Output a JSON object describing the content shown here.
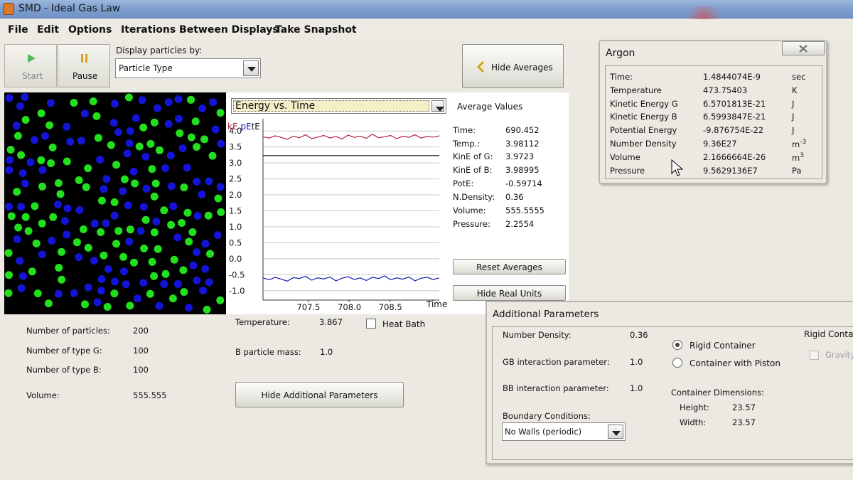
{
  "window": {
    "title": "SMD - Ideal Gas Law"
  },
  "menu": [
    "File",
    "Edit",
    "Options",
    "Iterations Between Displays",
    "Take Snapshot"
  ],
  "toolbar": {
    "start_label": "Start",
    "pause_label": "Pause",
    "display_by_label": "Display particles by:",
    "display_by_value": "Particle Type",
    "hide_averages_label": "Hide Averages"
  },
  "colors": {
    "type_g": "#22e01e",
    "type_b": "#1414d8",
    "ke_line": "#b0203c",
    "pe_line": "#1a1ab0",
    "te_line": "#111111"
  },
  "plot": {
    "selector_value": "Energy vs. Time",
    "legend": {
      "ke": "kE",
      "pe": "pE",
      "te": "tE"
    },
    "x_axis_label": "Time"
  },
  "chart_data": {
    "type": "line",
    "xlabel": "Time",
    "ylabel": "",
    "x_ticks": [
      "707.5",
      "708.0",
      "708.5"
    ],
    "y_ticks": [
      "4.0",
      "3.5",
      "3.0",
      "2.5",
      "2.0",
      "1.5",
      "1.0",
      "0.5",
      "0.0",
      "-0.5",
      "-1.0"
    ],
    "ylim": [
      -1.25,
      4.25
    ],
    "xlim": [
      706.95,
      709.1
    ],
    "series": [
      {
        "name": "kE",
        "color": "#b0203c",
        "values": [
          3.82,
          3.78,
          3.85,
          3.8,
          3.74,
          3.84,
          3.79,
          3.88,
          3.76,
          3.81,
          3.86,
          3.78,
          3.83,
          3.75,
          3.87,
          3.8,
          3.84,
          3.77,
          3.9,
          3.79,
          3.82,
          3.86,
          3.76,
          3.84,
          3.8,
          3.88,
          3.78,
          3.83,
          3.81,
          3.85
        ]
      },
      {
        "name": "tE",
        "color": "#111111",
        "values": [
          3.23,
          3.23,
          3.23,
          3.23,
          3.23,
          3.23,
          3.23,
          3.23,
          3.23,
          3.23,
          3.23,
          3.23,
          3.23,
          3.23,
          3.23,
          3.23,
          3.23,
          3.23,
          3.23,
          3.23,
          3.23,
          3.23,
          3.23,
          3.23,
          3.23,
          3.23,
          3.23,
          3.23,
          3.23,
          3.23
        ]
      },
      {
        "name": "pE",
        "color": "#1a1ab0",
        "values": [
          -0.6,
          -0.66,
          -0.58,
          -0.64,
          -0.7,
          -0.59,
          -0.62,
          -0.55,
          -0.67,
          -0.6,
          -0.63,
          -0.57,
          -0.69,
          -0.61,
          -0.56,
          -0.65,
          -0.6,
          -0.68,
          -0.58,
          -0.62,
          -0.54,
          -0.66,
          -0.6,
          -0.64,
          -0.57,
          -0.69,
          -0.61,
          -0.58,
          -0.65,
          -0.6
        ]
      }
    ]
  },
  "averages": {
    "title": "Average Values",
    "rows": [
      {
        "label": "Time:",
        "value": "690.452"
      },
      {
        "label": "Temp.:",
        "value": "3.98112"
      },
      {
        "label": "KinE of G:",
        "value": "3.9723"
      },
      {
        "label": "KinE of B:",
        "value": "3.98995"
      },
      {
        "label": "PotE:",
        "value": "-0.59714"
      },
      {
        "label": "N.Density:",
        "value": "0.36"
      },
      {
        "label": "Volume:",
        "value": "555.5555"
      },
      {
        "label": "Pressure:",
        "value": "2.2554"
      }
    ],
    "reset_label": "Reset Averages",
    "hide_units_label": "Hide Real Units"
  },
  "stats": {
    "rows": [
      {
        "label": "Number of particles:",
        "value": "200"
      },
      {
        "label": "Number of type G:",
        "value": "100"
      },
      {
        "label": "Number of type B:",
        "value": "100"
      },
      {
        "label": "Volume:",
        "value": "555.555"
      }
    ]
  },
  "controls": {
    "temperature_label": "Temperature:",
    "temperature_value": "3.867",
    "heat_bath_label": "Heat Bath",
    "b_mass_label": "B particle mass:",
    "b_mass_value": "1.0",
    "hide_params_label": "Hide Additional Parameters"
  },
  "argon": {
    "title": "Argon",
    "rows": [
      {
        "label": "Time:",
        "value": "1.4844074E-9",
        "unit": "sec",
        "sup": ""
      },
      {
        "label": "Temperature",
        "value": "473.75403",
        "unit": "K",
        "sup": ""
      },
      {
        "label": "Kinetic Energy G",
        "value": "6.5701813E-21",
        "unit": "J",
        "sup": ""
      },
      {
        "label": "Kinetic Energy B",
        "value": "6.5993847E-21",
        "unit": "J",
        "sup": ""
      },
      {
        "label": "Potential Energy",
        "value": "-9.876754E-22",
        "unit": "J",
        "sup": ""
      },
      {
        "label": "Number Density",
        "value": "9.36E27",
        "unit": "m",
        "sup": "-3"
      },
      {
        "label": "Volume",
        "value": "2.1666664E-26",
        "unit": "m",
        "sup": "3"
      },
      {
        "label": "Pressure",
        "value": "9.5629136E7",
        "unit": "Pa",
        "sup": ""
      }
    ]
  },
  "additional": {
    "title": "Additional Parameters",
    "number_density_label": "Number Density:",
    "number_density_value": "0.36",
    "gb_label": "GB interaction parameter:",
    "gb_value": "1.0",
    "bb_label": "BB interaction parameter:",
    "bb_value": "1.0",
    "boundary_label": "Boundary Conditions:",
    "boundary_value": "No Walls (periodic)",
    "rigid_label": "Rigid Container",
    "piston_label": "Container with Piston",
    "dims_label": "Container Dimensions:",
    "height_label": "Height:",
    "height_value": "23.57",
    "width_label": "Width:",
    "width_value": "23.57",
    "rigid_side_label": "Rigid Conta",
    "gravity_label": "Gravity"
  }
}
